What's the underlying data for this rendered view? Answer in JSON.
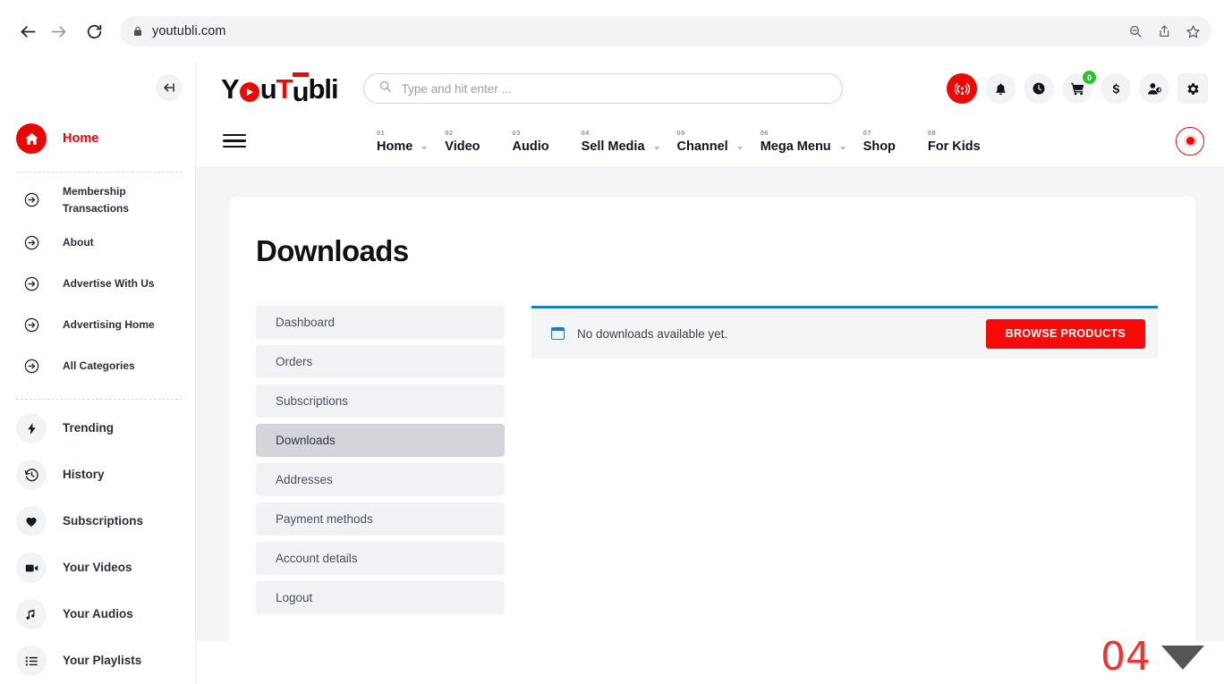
{
  "browser": {
    "back_icon": "arrow-left-icon",
    "forward_icon": "arrow-right-icon",
    "reload_icon": "reload-icon",
    "lock_icon": "lock-icon",
    "url": "youtubli.com",
    "toolbar_icons": [
      "zoom-out-icon",
      "share-icon",
      "bookmark-star-icon"
    ]
  },
  "sidebar": {
    "collapse_icon": "collapse-sidebar-icon",
    "home": {
      "label": "Home",
      "icon": "home-icon"
    },
    "links": [
      {
        "label": "Membership Transactions",
        "icon": "circle-arrow-icon"
      },
      {
        "label": "About",
        "icon": "circle-arrow-icon"
      },
      {
        "label": "Advertise With Us",
        "icon": "circle-arrow-icon"
      },
      {
        "label": "Advertising Home",
        "icon": "circle-arrow-icon"
      },
      {
        "label": "All Categories",
        "icon": "circle-arrow-icon"
      }
    ],
    "sections": [
      {
        "label": "Trending",
        "icon": "lightning-icon"
      },
      {
        "label": "History",
        "icon": "history-icon"
      },
      {
        "label": "Subscriptions",
        "icon": "heart-icon"
      },
      {
        "label": "Your Videos",
        "icon": "video-camera-icon"
      },
      {
        "label": "Your Audios",
        "icon": "music-note-icon"
      },
      {
        "label": "Your Playlists",
        "icon": "playlist-icon"
      }
    ]
  },
  "header": {
    "logo": {
      "part1": "Y",
      "play": "play-circle-icon",
      "part2": "u",
      "part3": "T",
      "part4": "u",
      "part5": "bli"
    },
    "search": {
      "placeholder": "Type and hit enter ...",
      "value": "",
      "icon": "search-icon"
    },
    "icons": [
      {
        "name": "live-broadcast-icon",
        "style": "live",
        "badge": ""
      },
      {
        "name": "bell-icon",
        "style": "plain",
        "badge": ""
      },
      {
        "name": "clock-icon",
        "style": "plain",
        "badge": ""
      },
      {
        "name": "cart-icon",
        "style": "plain",
        "badge": "0"
      },
      {
        "name": "dollar-icon",
        "style": "plain",
        "badge": ""
      },
      {
        "name": "add-user-icon",
        "style": "plain",
        "badge": ""
      },
      {
        "name": "gear-icon",
        "style": "square",
        "badge": ""
      }
    ]
  },
  "nav": {
    "menu_icon": "hamburger-icon",
    "items": [
      {
        "num": "01",
        "label": "Home",
        "caret": true
      },
      {
        "num": "02",
        "label": "Video",
        "caret": false
      },
      {
        "num": "03",
        "label": "Audio",
        "caret": false
      },
      {
        "num": "04",
        "label": "Sell Media",
        "caret": true
      },
      {
        "num": "05",
        "label": "Channel",
        "caret": true
      },
      {
        "num": "06",
        "label": "Mega Menu",
        "caret": true
      },
      {
        "num": "07",
        "label": "Shop",
        "caret": false
      },
      {
        "num": "08",
        "label": "For Kids",
        "caret": false
      }
    ],
    "record_button_icon": "record-icon"
  },
  "main": {
    "title": "Downloads",
    "account_nav": [
      {
        "label": "Dashboard",
        "active": false
      },
      {
        "label": "Orders",
        "active": false
      },
      {
        "label": "Subscriptions",
        "active": false
      },
      {
        "label": "Downloads",
        "active": true
      },
      {
        "label": "Addresses",
        "active": false
      },
      {
        "label": "Payment methods",
        "active": false
      },
      {
        "label": "Account details",
        "active": false
      },
      {
        "label": "Logout",
        "active": false
      }
    ],
    "notice": {
      "icon": "info-box-icon",
      "text": "No downloads available yet.",
      "button_label": "BROWSE PRODUCTS",
      "accent_color": "#1a7fc1",
      "button_color": "#fb0909"
    }
  },
  "slide_marker": {
    "number": "04",
    "arrow_icon": "triangle-down-icon"
  },
  "colors": {
    "brand_red": "#ee0707",
    "page_bg": "#f4f5f7",
    "card_bg": "#ffffff",
    "notice_accent": "#1a7fc1",
    "badge_green": "#2fc22f"
  }
}
